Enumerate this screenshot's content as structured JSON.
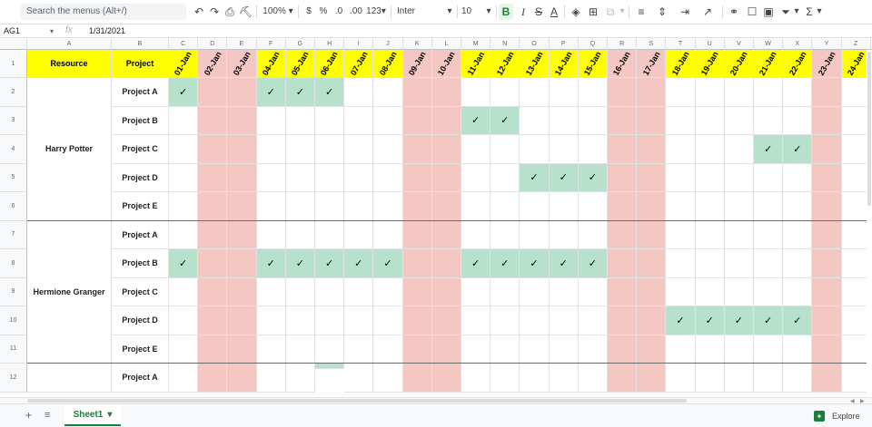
{
  "toolbar": {
    "search_placeholder": "Search the menus (Alt+/)",
    "zoom": "100%",
    "currency": "$",
    "percent": "%",
    "dec_decrease": ".0",
    "dec_increase": ".00",
    "number_format": "123",
    "font": "Inter",
    "font_size": "10",
    "bold": "B",
    "italic": "I",
    "strike": "S",
    "text_color": "A"
  },
  "formula_bar": {
    "name_box": "AG1",
    "fx": "fx",
    "value": "1/31/2021"
  },
  "columns": [
    "A",
    "B",
    "C",
    "D",
    "E",
    "F",
    "G",
    "H",
    "I",
    "J",
    "K",
    "L",
    "M",
    "N",
    "O",
    "P",
    "Q",
    "R",
    "S",
    "T",
    "U",
    "V",
    "W",
    "X",
    "Y",
    "Z"
  ],
  "header": {
    "resource": "Resource",
    "project": "Project",
    "dates": [
      "01-Jan",
      "02-Jan",
      "03-Jan",
      "04-Jan",
      "05-Jan",
      "06-Jan",
      "07-Jan",
      "08-Jan",
      "09-Jan",
      "10-Jan",
      "11-Jan",
      "12-Jan",
      "13-Jan",
      "14-Jan",
      "15-Jan",
      "16-Jan",
      "17-Jan",
      "18-Jan",
      "19-Jan",
      "20-Jan",
      "21-Jan",
      "22-Jan",
      "23-Jan",
      "24-Jan"
    ]
  },
  "weekend_index": [
    1,
    2,
    8,
    9,
    15,
    16,
    22
  ],
  "check_mark": "✓",
  "row_numbers": [
    "1",
    "2",
    "3",
    "4",
    "5",
    "6",
    "7",
    "8",
    "9",
    "10",
    "11",
    "12"
  ],
  "resources": [
    {
      "name": "Harry Potter",
      "projects": [
        {
          "name": "Project A",
          "checks": [
            0,
            3,
            4,
            5
          ],
          "green_extra": []
        },
        {
          "name": "Project B",
          "checks": [
            10,
            11
          ],
          "green_extra": []
        },
        {
          "name": "Project C",
          "checks": [
            20,
            21
          ],
          "green_extra": []
        },
        {
          "name": "Project D",
          "checks": [
            12,
            13,
            14
          ],
          "green_extra": []
        },
        {
          "name": "Project E",
          "checks": [],
          "green_extra": []
        }
      ]
    },
    {
      "name": "Hermione Granger",
      "projects": [
        {
          "name": "Project A",
          "checks": [],
          "green_extra": []
        },
        {
          "name": "Project B",
          "checks": [
            0,
            3,
            4,
            5,
            6,
            7,
            10,
            11,
            12,
            13,
            14
          ],
          "green_extra": []
        },
        {
          "name": "Project C",
          "checks": [],
          "green_extra": []
        },
        {
          "name": "Project D",
          "checks": [
            17,
            18,
            19,
            20,
            21
          ],
          "green_extra": []
        },
        {
          "name": "Project E",
          "checks": [],
          "green_extra": []
        }
      ]
    },
    {
      "name": "",
      "projects": [
        {
          "name": "Project A",
          "checks": [],
          "green_extra": [
            5
          ]
        }
      ]
    }
  ],
  "sheet": {
    "name": "Sheet1"
  },
  "explore": "Explore",
  "colors": {
    "header_bg": "#ffff00",
    "weekend": "#f4c7c3",
    "assigned": "#b7e1cd",
    "accent": "#188038"
  }
}
